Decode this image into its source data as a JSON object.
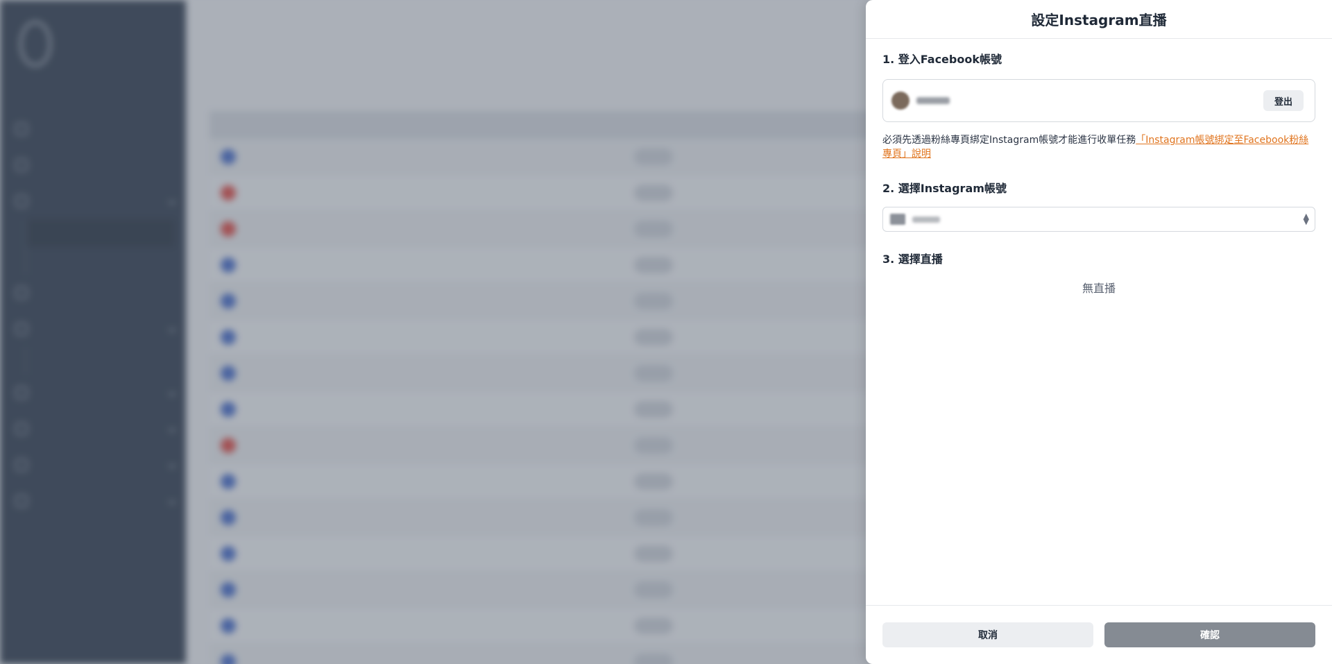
{
  "drawer": {
    "title": "設定Instagram直播",
    "step1": "1. 登入Facebook帳號",
    "logout_label": "登出",
    "notice_text": "必須先透過粉絲專頁綁定Instagram帳號才能進行收單任務",
    "notice_link": "「Instagram帳號綁定至Facebook粉絲專頁」說明",
    "step2": "2. 選擇Instagram帳號",
    "step3": "3. 選擇直播",
    "empty_text": "無直播",
    "cancel_label": "取消",
    "confirm_label": "確認"
  },
  "colors": {
    "link": "#e0741e",
    "confirm_button": "#858b93",
    "sidebar": "#253245",
    "active_nav": "#d99a2b"
  },
  "icons": {
    "select_caret": "chevron-up-down-icon"
  }
}
